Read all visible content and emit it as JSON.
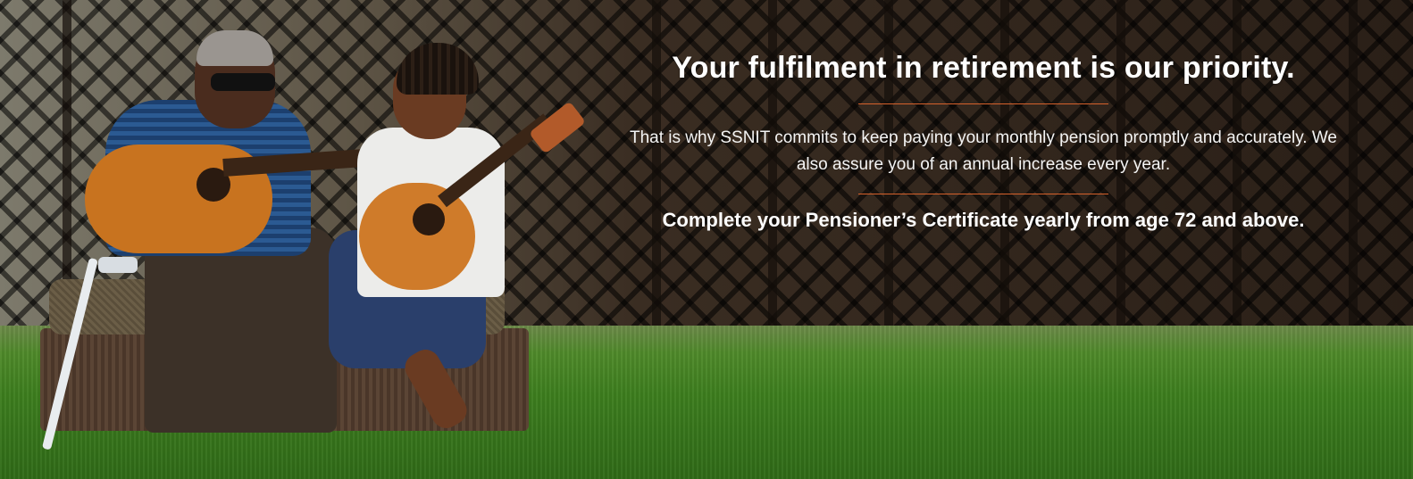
{
  "banner": {
    "headline": "Your fulfilment in retirement is our priority.",
    "body": "That is why SSNIT commits to keep paying your monthly pension promptly and accurately. We also assure you of an annual increase every year.",
    "cta": "Complete your Pensioner’s Certificate yearly from age 72 and above.",
    "accent_color": "#d6612b",
    "photo": "man-and-girl-playing-guitars"
  }
}
